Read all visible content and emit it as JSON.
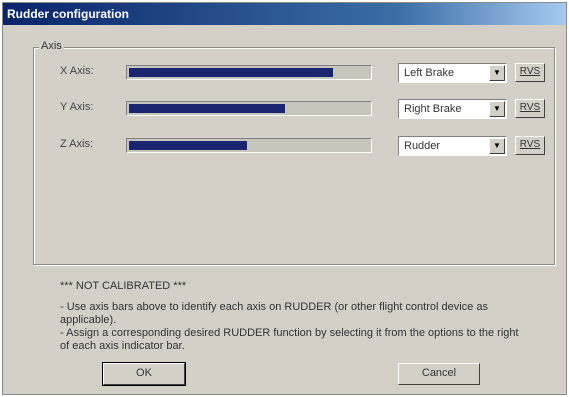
{
  "window": {
    "title": "Rudder configuration"
  },
  "group": {
    "label": "Axis"
  },
  "axes": [
    {
      "label": "X Axis:",
      "fill_percent": 85,
      "selection": "Left Brake",
      "rvs_label": "RVS"
    },
    {
      "label": "Y Axis:",
      "fill_percent": 65,
      "selection": "Right Brake",
      "rvs_label": "RVS"
    },
    {
      "label": "Z Axis:",
      "fill_percent": 49,
      "selection": "Rudder",
      "rvs_label": "RVS"
    }
  ],
  "notice": {
    "heading": "*** NOT CALIBRATED ***",
    "line1": "- Use axis bars above to identify each axis on RUDDER (or other flight control device as applicable).",
    "line2": "- Assign a corresponding desired RUDDER function by selecting it from the options to the right of each axis indicator bar."
  },
  "buttons": {
    "ok": "OK",
    "cancel": "Cancel"
  },
  "colors": {
    "bar_fill": "#1a2570",
    "title_bar": "#0a246a"
  }
}
